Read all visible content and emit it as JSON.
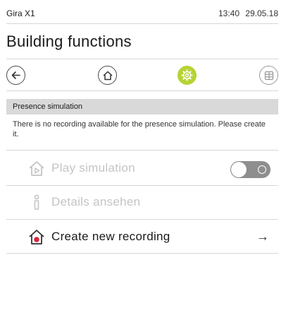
{
  "status_bar": {
    "device": "Gira X1",
    "time": "13:40",
    "date": "29.05.18"
  },
  "page": {
    "title": "Building functions"
  },
  "nav": {
    "items": [
      {
        "name": "back-icon"
      },
      {
        "name": "home-icon"
      },
      {
        "name": "settings-gear-icon",
        "active": true
      },
      {
        "name": "grid-icon"
      }
    ],
    "accent_color": "#b5d334"
  },
  "section": {
    "header": "Presence simulation",
    "info": "There is no recording available for the presence simulation. Please create it."
  },
  "rows": {
    "play": {
      "label": "Play simulation",
      "enabled": false,
      "toggle_on": false
    },
    "details": {
      "label": "Details ansehen",
      "enabled": false
    },
    "create": {
      "label": "Create new recording",
      "enabled": true,
      "arrow": "→"
    }
  }
}
